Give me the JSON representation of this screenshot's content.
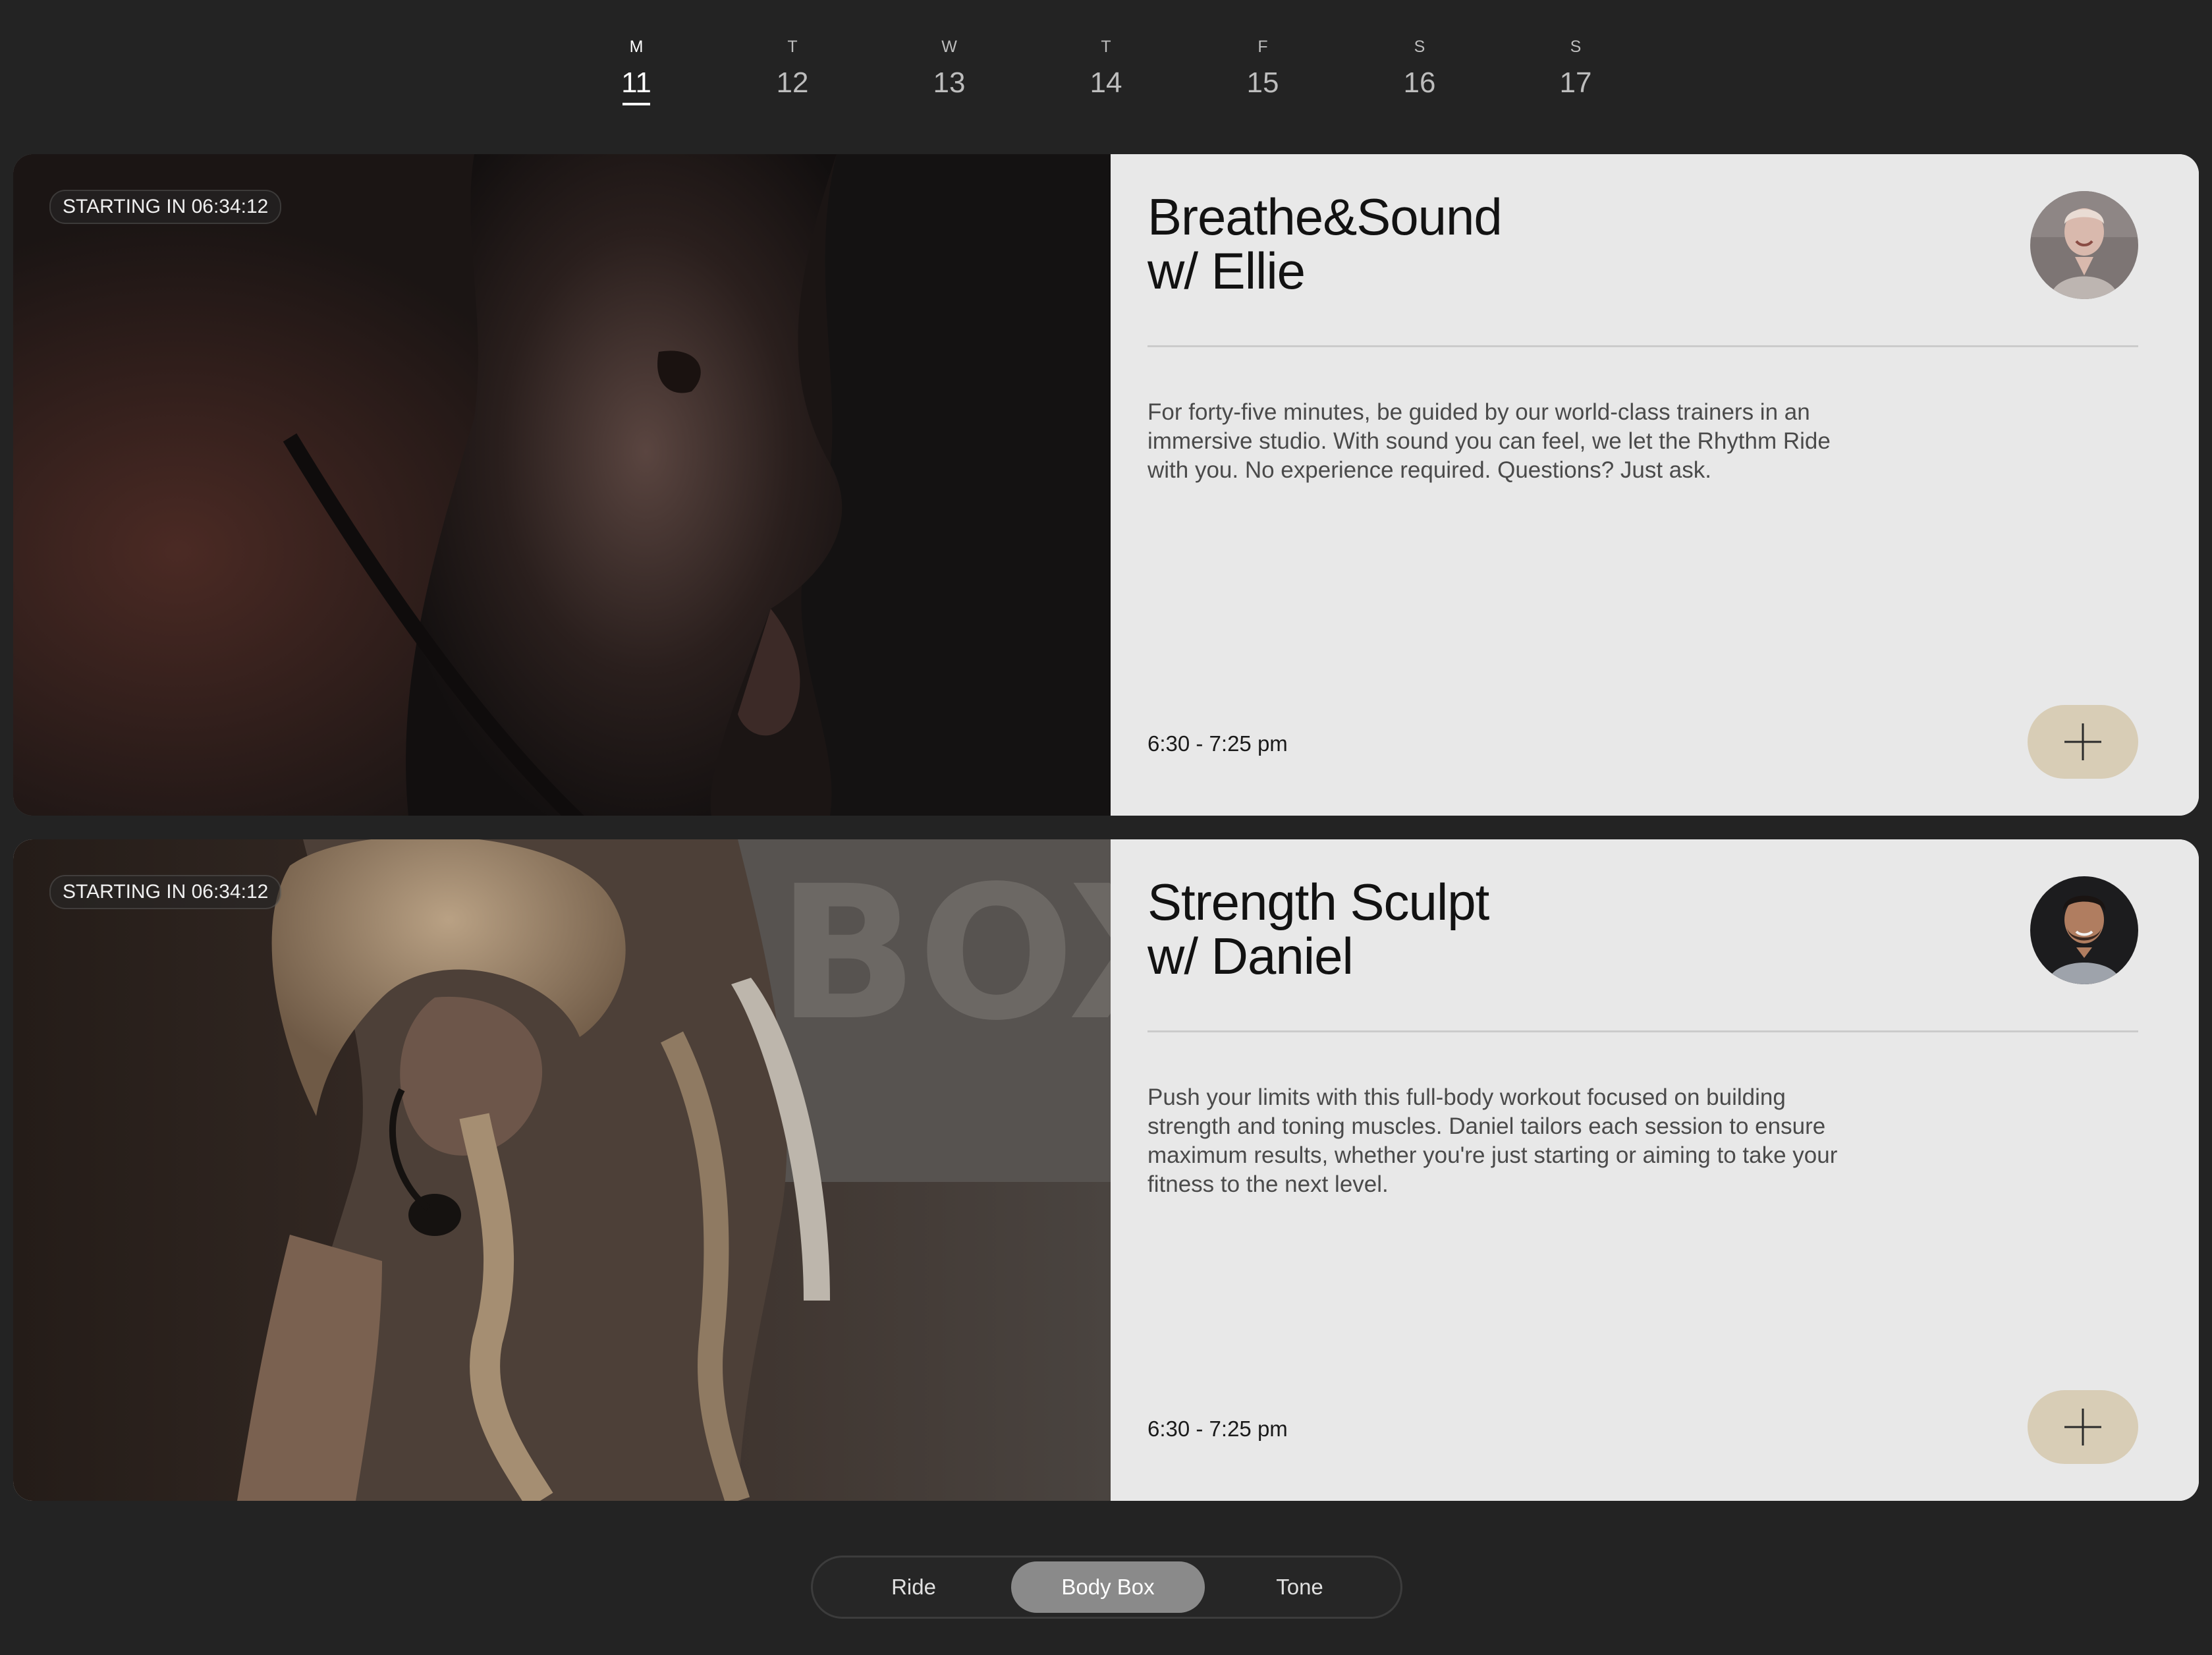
{
  "week": {
    "days": [
      {
        "letter": "M",
        "number": "11",
        "active": true
      },
      {
        "letter": "T",
        "number": "12"
      },
      {
        "letter": "W",
        "number": "13"
      },
      {
        "letter": "T",
        "number": "14"
      },
      {
        "letter": "F",
        "number": "15"
      },
      {
        "letter": "S",
        "number": "16"
      },
      {
        "letter": "S",
        "number": "17"
      }
    ]
  },
  "classes": [
    {
      "badge": "STARTING IN 06:34:12",
      "title_line1": "Breathe&Sound",
      "title_line2": "w/ Ellie",
      "description": "For forty-five minutes, be guided by our world-class trainers in an immersive studio. With sound you can feel, we let the Rhythm Ride with you. No experience required. Questions? Just ask.",
      "time": "6:30 - 7:25 pm",
      "add_icon": "plus-icon"
    },
    {
      "badge": "STARTING IN 06:34:12",
      "title_line1": "Strength Sculpt",
      "title_line2": "w/ Daniel",
      "description": "Push your limits with this full-body workout focused on building strength and toning muscles. Daniel tailors each session to ensure maximum results, whether you're just starting or aiming to take your fitness to the next level.",
      "time": "6:30 - 7:25 pm",
      "add_icon": "plus-icon"
    }
  ],
  "category_tabs": [
    {
      "label": "Ride"
    },
    {
      "label": "Body Box",
      "active": true
    },
    {
      "label": "Tone"
    }
  ],
  "colors": {
    "background": "#232323",
    "card": "#e8e8e8",
    "add_button": "#d8cdb6",
    "active_tab": "#8a8a8a"
  }
}
